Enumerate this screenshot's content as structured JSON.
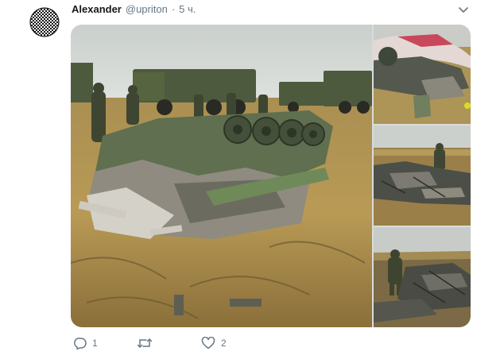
{
  "tweet": {
    "author": {
      "name": "Alexander",
      "handle": "@upriton",
      "avatar_icon": "checkered-circle-avatar"
    },
    "separator": "·",
    "timestamp": "5 ч.",
    "menu_icon": "chevron-down-icon",
    "media": {
      "photo_count": 4,
      "photos": [
        {
          "description_icon": "wreckage-photo-main"
        },
        {
          "description_icon": "wreckage-photo-parachute"
        },
        {
          "description_icon": "wreckage-photo-soldier"
        },
        {
          "description_icon": "wreckage-photo-debris"
        }
      ]
    },
    "actions": {
      "reply": {
        "icon": "reply-icon",
        "count": "1"
      },
      "retweet": {
        "icon": "retweet-icon",
        "count": ""
      },
      "like": {
        "icon": "heart-icon",
        "count": "2"
      }
    },
    "colors": {
      "text_primary": "#14171a",
      "text_secondary": "#657786"
    }
  }
}
